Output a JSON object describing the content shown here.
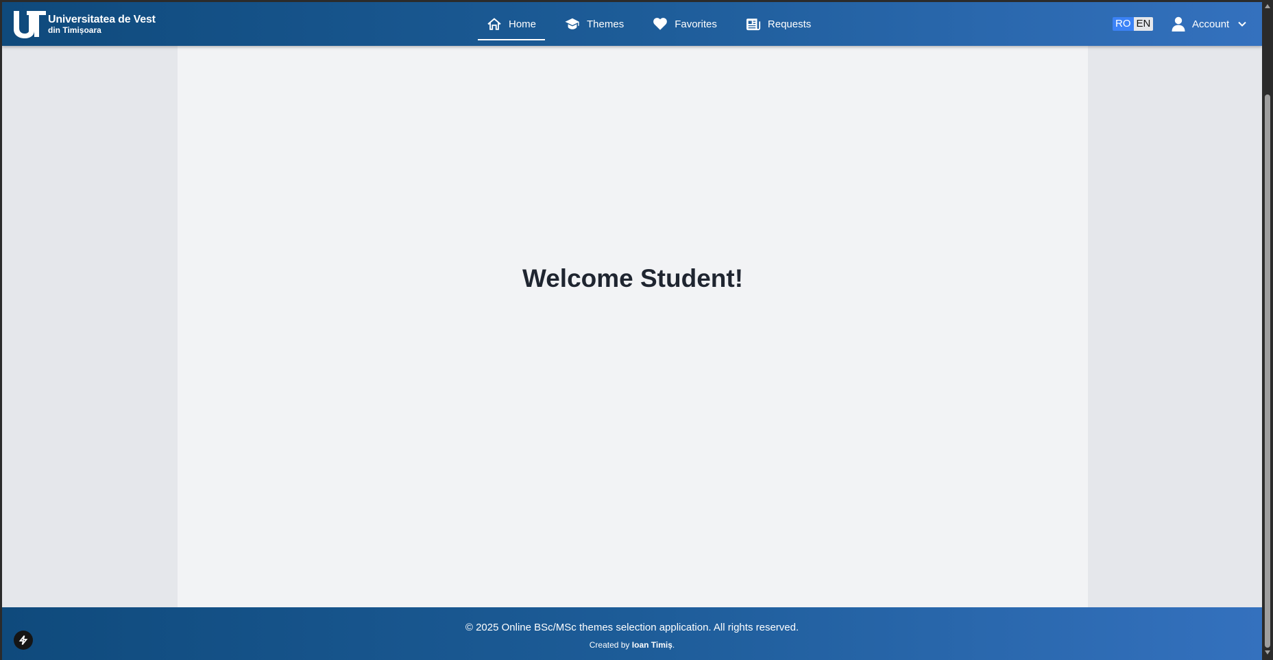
{
  "header": {
    "logo": {
      "line1": "Universitatea de Vest",
      "line2": "din Timișoara"
    },
    "nav": [
      {
        "label": "Home",
        "icon": "home-icon",
        "active": true
      },
      {
        "label": "Themes",
        "icon": "graduation-cap-icon",
        "active": false
      },
      {
        "label": "Favorites",
        "icon": "heart-icon",
        "active": false
      },
      {
        "label": "Requests",
        "icon": "newspaper-icon",
        "active": false
      }
    ],
    "language": {
      "ro": "RO",
      "en": "EN",
      "selected": "RO"
    },
    "account": {
      "label": "Account",
      "icon": "user-icon"
    }
  },
  "main": {
    "heading": "Welcome Student!"
  },
  "footer": {
    "copyright": "© 2025 Online BSc/MSc themes selection application. All rights reserved.",
    "created_by_prefix": "Created by",
    "author": "Ioan Timiș",
    "suffix": "."
  },
  "colors": {
    "header_gradient_start": "#0f4a7c",
    "header_gradient_end": "#3471be",
    "panel_bg": "#f2f3f5",
    "page_bg": "#e5e7eb",
    "lang_active": "#3b82f6"
  }
}
